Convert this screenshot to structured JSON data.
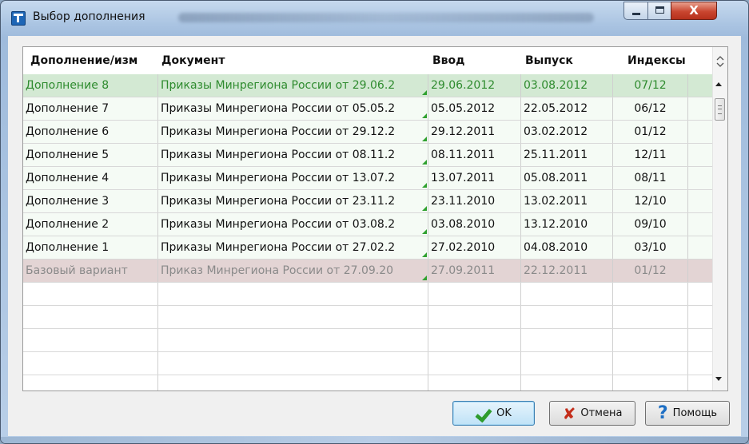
{
  "window": {
    "title": "Выбор дополнения"
  },
  "title_controls": {
    "close_glyph": "X"
  },
  "table": {
    "columns": [
      "Дополнение/изм",
      "Документ",
      "Ввод",
      "Выпуск",
      "Индексы"
    ],
    "rows": [
      [
        "Дополнение 8",
        "Приказы Минрегиона России от 29.06.2",
        "29.06.2012",
        "03.08.2012",
        "07/12"
      ],
      [
        "Дополнение 7",
        "Приказы Минрегиона России от 05.05.2",
        "05.05.2012",
        "22.05.2012",
        "06/12"
      ],
      [
        "Дополнение 6",
        "Приказы Минрегиона России от 29.12.2",
        "29.12.2011",
        "03.02.2012",
        "01/12"
      ],
      [
        "Дополнение 5",
        "Приказы Минрегиона России от 08.11.2",
        "08.11.2011",
        "25.11.2011",
        "12/11"
      ],
      [
        "Дополнение 4",
        "Приказы Минрегиона России от 13.07.2",
        "13.07.2011",
        "05.08.2011",
        "08/11"
      ],
      [
        "Дополнение 3",
        "Приказы Минрегиона России от 23.11.2",
        "23.11.2010",
        "13.02.2011",
        "12/10"
      ],
      [
        "Дополнение 2",
        "Приказы Минрегиона России от 03.08.2",
        "03.08.2010",
        "13.12.2010",
        "09/10"
      ],
      [
        "Дополнение 1",
        "Приказы Минрегиона России от 27.02.2",
        "27.02.2010",
        "04.08.2010",
        "03/10"
      ],
      [
        "Базовый вариант",
        "Приказ Минрегиона России от 27.09.20",
        "27.09.2011",
        "22.12.2011",
        "01/12"
      ]
    ]
  },
  "buttons": {
    "ok": "OK",
    "cancel": "Отмена",
    "help": "Помощь"
  },
  "colors": {
    "selected_row_bg": "#d3e9d3",
    "selected_row_text": "#2e8b2e",
    "base_row_bg": "#e3d4d4",
    "ok_accent": "#2e9c2e",
    "cancel_accent": "#c42d1a",
    "help_accent": "#1e6fc4"
  },
  "icons": {
    "app": "app-icon",
    "ok": "checkmark-icon",
    "cancel": "x-icon",
    "help": "question-icon"
  }
}
